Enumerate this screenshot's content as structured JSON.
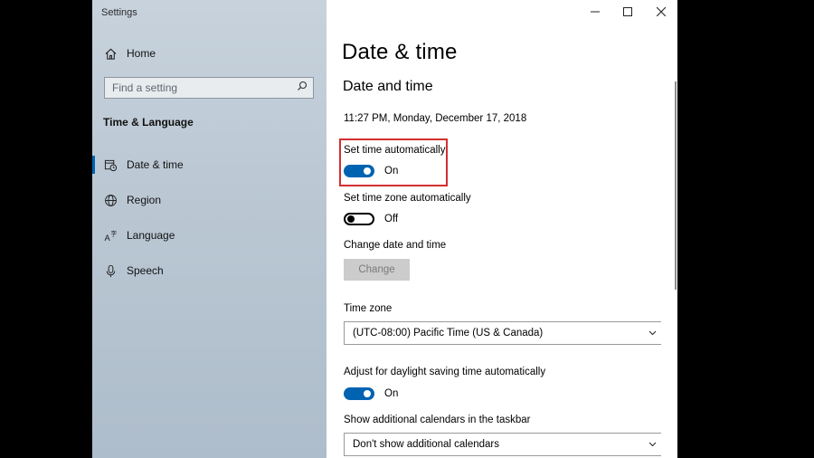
{
  "window": {
    "title": "Settings"
  },
  "sidebar": {
    "home_label": "Home",
    "search_placeholder": "Find a setting",
    "section_heading": "Time & Language",
    "items": [
      {
        "label": "Date & time",
        "icon": "calendar-clock-icon",
        "active": true
      },
      {
        "label": "Region",
        "icon": "globe-icon",
        "active": false
      },
      {
        "label": "Language",
        "icon": "language-icon",
        "active": false
      },
      {
        "label": "Speech",
        "icon": "microphone-icon",
        "active": false
      }
    ]
  },
  "main": {
    "page_title": "Date & time",
    "section_title": "Date and time",
    "current_datetime": "11:27 PM, Monday, December 17, 2018",
    "set_time_auto": {
      "label": "Set time automatically",
      "state": "On",
      "on": true
    },
    "set_timezone_auto": {
      "label": "Set time zone automatically",
      "state": "Off",
      "on": false
    },
    "change_date_time": {
      "label": "Change date and time",
      "button": "Change"
    },
    "time_zone": {
      "label": "Time zone",
      "value": "(UTC-08:00) Pacific Time (US & Canada)"
    },
    "daylight_saving": {
      "label": "Adjust for daylight saving time automatically",
      "state": "On",
      "on": true
    },
    "additional_calendars": {
      "label": "Show additional calendars in the taskbar",
      "value": "Don't show additional calendars"
    }
  },
  "colors": {
    "accent": "#0063b1",
    "highlight": "#d32f2f",
    "sidebar_bg": "#bac7d3"
  }
}
